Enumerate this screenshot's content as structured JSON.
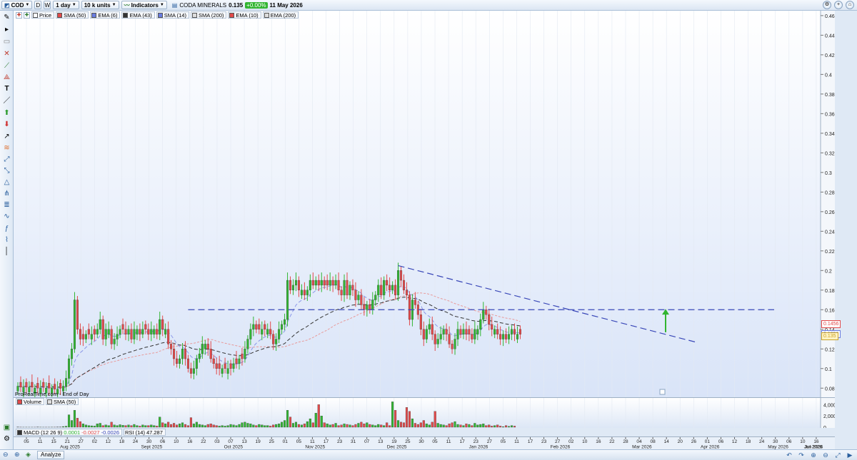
{
  "toolbar": {
    "symbol": "COD",
    "period_d": "D",
    "period_w": "W",
    "timeframe": "1 day",
    "units": "10 k units",
    "indicators_label": "Indicators",
    "instrument_name": "CODA MINERALS",
    "last_price": "0.135",
    "change": "+0.00%",
    "date": "11 May 2026"
  },
  "legend_price": [
    {
      "label": "Price",
      "color": "#ffffff"
    },
    {
      "label": "SMA (50)",
      "color": "#e24a4a"
    },
    {
      "label": "EMA (6)",
      "color": "#6a7de0"
    },
    {
      "label": "EMA (43)",
      "color": "#333333"
    },
    {
      "label": "SMA (14)",
      "color": "#6a7de0"
    },
    {
      "label": "SMA (200)",
      "color": "#dddddd"
    },
    {
      "label": "EMA (10)",
      "color": "#e24a4a"
    },
    {
      "label": "EMA (200)",
      "color": "#dddddd"
    }
  ],
  "legend_volume": [
    {
      "label": "Volume",
      "color": "#e24a4a"
    },
    {
      "label": "SMA (50)",
      "color": "#dddddd"
    }
  ],
  "legend_indicators": {
    "macd_label": "MACD (12 26 9)",
    "macd_v1": "0.0001",
    "macd_v2": "-0.0027",
    "macd_v3": "-0.0026",
    "rsi_label": "RSI (14)",
    "rsi_value": "47.287"
  },
  "credit": "ProRealTime.com - End of Day",
  "price_tags": [
    {
      "text": "0.1456",
      "color": "#e24a4a"
    },
    {
      "text": "0.1356",
      "color": "#6a7de0"
    },
    {
      "text": "0.135",
      "color": "#c9a227"
    }
  ],
  "bottom": {
    "analyze_label": "Analyze"
  },
  "colors": {
    "up": "#31b531",
    "down": "#e24a4a",
    "trend": "#3a48b8",
    "bg_top": "#ffffff",
    "bg_bottom": "#d9e4f8"
  },
  "chart_data": {
    "type": "candlestick",
    "title": "",
    "y_axis_ticks": [
      "0.46",
      "0.44",
      "0.42",
      "0.4",
      "0.38",
      "0.36",
      "0.34",
      "0.32",
      "0.3",
      "0.28",
      "0.26",
      "0.24",
      "0.22",
      "0.2",
      "0.18",
      "0.16",
      "0.14",
      "0.12",
      "0.1",
      "0.08"
    ],
    "ylim": [
      0.07,
      0.465
    ],
    "volume_axis_ticks": [
      "4,000k",
      "2,000k",
      "0"
    ],
    "volume_max": 4800,
    "x_axis_days": [
      "05",
      "11",
      "15",
      "21",
      "27",
      "02",
      "12",
      "18",
      "24",
      "30",
      "06",
      "10",
      "16",
      "22",
      "03",
      "07",
      "13",
      "19",
      "25",
      "01",
      "05",
      "11",
      "17",
      "23",
      "31",
      "07",
      "13",
      "19",
      "25",
      "30",
      "05",
      "11",
      "17",
      "23",
      "27",
      "05",
      "11",
      "17",
      "23",
      "27",
      "02",
      "10",
      "16",
      "22",
      "28",
      "04",
      "08",
      "14",
      "20",
      "26",
      "01",
      "06",
      "12",
      "18",
      "24",
      "30",
      "06",
      "10",
      "16"
    ],
    "x_axis_months": [
      "Aug 2025",
      "Sept 2025",
      "Oct 2025",
      "Nov 2025",
      "Dec 2025",
      "Jan 2026",
      "Feb 2026",
      "Mar 2026",
      "Apr 2026",
      "May 2026",
      "Jun 2026",
      "Jul 2026"
    ],
    "horizontal_line": 0.16,
    "trendline": {
      "from": [
        "Feb 2026",
        0.205
      ],
      "to": [
        "May 2026",
        0.125
      ]
    },
    "close": [
      0.082,
      0.081,
      0.081,
      0.081,
      0.081,
      0.081,
      0.08,
      0.08,
      0.08,
      0.081,
      0.08,
      0.08,
      0.08,
      0.079,
      0.079,
      0.08,
      0.082,
      0.09,
      0.11,
      0.12,
      0.17,
      0.14,
      0.13,
      0.13,
      0.135,
      0.135,
      0.135,
      0.135,
      0.14,
      0.15,
      0.13,
      0.14,
      0.14,
      0.125,
      0.13,
      0.135,
      0.14,
      0.14,
      0.135,
      0.14,
      0.13,
      0.14,
      0.14,
      0.135,
      0.14,
      0.14,
      0.135,
      0.14,
      0.14,
      0.135,
      0.15,
      0.14,
      0.14,
      0.125,
      0.12,
      0.11,
      0.105,
      0.11,
      0.12,
      0.11,
      0.1,
      0.095,
      0.1,
      0.11,
      0.115,
      0.125,
      0.125,
      0.12,
      0.11,
      0.105,
      0.1,
      0.1,
      0.1,
      0.1,
      0.1,
      0.1,
      0.105,
      0.105,
      0.11,
      0.11,
      0.12,
      0.13,
      0.14,
      0.145,
      0.14,
      0.14,
      0.14,
      0.14,
      0.14,
      0.135,
      0.125,
      0.13,
      0.14,
      0.145,
      0.15,
      0.19,
      0.18,
      0.185,
      0.19,
      0.18,
      0.18,
      0.175,
      0.18,
      0.19,
      0.185,
      0.19,
      0.185,
      0.19,
      0.185,
      0.185,
      0.19,
      0.185,
      0.19,
      0.18,
      0.175,
      0.19,
      0.175,
      0.185,
      0.18,
      0.17,
      0.175,
      0.165,
      0.16,
      0.165,
      0.16,
      0.17,
      0.175,
      0.185,
      0.175,
      0.19,
      0.185,
      0.18,
      0.185,
      0.175,
      0.2,
      0.19,
      0.18,
      0.175,
      0.15,
      0.17,
      0.165,
      0.155,
      0.14,
      0.13,
      0.14,
      0.145,
      0.135,
      0.125,
      0.13,
      0.135,
      0.14,
      0.135,
      0.125,
      0.12,
      0.13,
      0.14,
      0.135,
      0.14,
      0.135,
      0.135,
      0.13,
      0.14,
      0.14,
      0.15,
      0.16,
      0.155,
      0.145,
      0.14,
      0.14,
      0.135,
      0.13,
      0.135,
      0.13,
      0.135,
      0.14,
      0.135,
      0.135,
      0.135
    ],
    "volume": [
      20,
      15,
      10,
      12,
      10,
      10,
      10,
      20,
      15,
      10,
      10,
      10,
      15,
      15,
      20,
      30,
      120,
      180,
      2200,
      1200,
      3000,
      1600,
      1000,
      600,
      400,
      300,
      250,
      200,
      600,
      700,
      300,
      400,
      300,
      900,
      400,
      300,
      450,
      350,
      300,
      400,
      300,
      500,
      300,
      200,
      400,
      300,
      300,
      400,
      300,
      200,
      1800,
      800,
      600,
      900,
      500,
      700,
      400,
      600,
      800,
      500,
      300,
      1700,
      600,
      900,
      500,
      400,
      300,
      500,
      600,
      400,
      300,
      200,
      300,
      200,
      300,
      500,
      400,
      300,
      500,
      800,
      900,
      700,
      600,
      400,
      300,
      500,
      400,
      300,
      300,
      200,
      400,
      500,
      600,
      900,
      1200,
      3000,
      1800,
      700,
      900,
      500,
      400,
      600,
      1000,
      1500,
      800,
      2500,
      4000,
      2000,
      800,
      600,
      400,
      500,
      700,
      300,
      400,
      600,
      500,
      400,
      300,
      500,
      700,
      900,
      600,
      800,
      500,
      400,
      300,
      500,
      400,
      300,
      800,
      300,
      4500,
      3000,
      1200,
      900,
      800,
      3500,
      2800,
      1500,
      700,
      500,
      800,
      1200,
      600,
      400,
      900,
      2800,
      700,
      500,
      400,
      300,
      600,
      800,
      1000,
      500,
      400,
      300,
      600,
      500,
      300,
      700,
      400,
      500,
      600,
      300,
      400,
      200,
      300,
      400,
      200,
      100,
      300,
      150,
      300,
      200
    ],
    "sma50": [],
    "ema43": [],
    "ema10": [],
    "ema6": []
  }
}
